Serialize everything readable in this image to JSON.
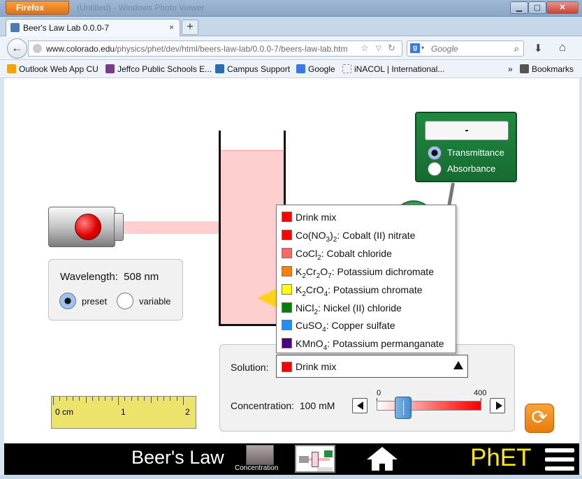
{
  "browser": {
    "firefox_label": "Firefox",
    "window_title": "(Untitled) - Windows Photo Viewer",
    "controls": {
      "minimize": "▁",
      "maximize": "▢",
      "close": "✕"
    },
    "tab": {
      "title": "Beer's Law Lab 0.0.0-7",
      "close": "×"
    },
    "new_tab": "+",
    "back": "←",
    "url_host": "www.colorado.edu",
    "url_path": "/physics/phet/dev/html/beers-law-lab/0.0.0-7/beers-law-lab.htm",
    "search_engine": "g",
    "search_placeholder": "Google",
    "bookmarks": [
      {
        "label": "Outlook Web App CU",
        "icon_color": "#f2a20c"
      },
      {
        "label": "Jeffco Public Schools E...",
        "icon_color": "#7a3b8f"
      },
      {
        "label": "Campus Support",
        "icon_color": "#2b6cb0"
      },
      {
        "label": "Google",
        "icon_color": "#3b78e7"
      },
      {
        "label": "iNACOL | International...",
        "icon_color": "#dddddd"
      }
    ],
    "bookmarks_overflow": "»",
    "bookmarks_menu": "Bookmarks"
  },
  "sim": {
    "wavelength": {
      "label": "Wavelength:",
      "value": "508 nm",
      "preset_label": "preset",
      "variable_label": "variable",
      "selected": "preset"
    },
    "meter": {
      "reading": "-",
      "transmittance_label": "Transmittance",
      "absorbance_label": "Absorbance",
      "selected": "transmittance"
    },
    "solution": {
      "label": "Solution:",
      "selected": "Drink mix",
      "selected_color": "#ff0000",
      "options": [
        {
          "label": "Drink mix",
          "color": "#ff0000"
        },
        {
          "label": "Co(NO3)2: Cobalt (II) nitrate",
          "color": "#ff0000"
        },
        {
          "label": "CoCl2: Cobalt chloride",
          "color": "#ff6666"
        },
        {
          "label": "K2Cr2O7: Potassium dichromate",
          "color": "#ff7f00"
        },
        {
          "label": "K2CrO4: Potassium chromate",
          "color": "#ffff00"
        },
        {
          "label": "NiCl2: Nickel (II) chloride",
          "color": "#008000"
        },
        {
          "label": "CuSO4: Copper sulfate",
          "color": "#1e90ff"
        },
        {
          "label": "KMnO4: Potassium permanganate",
          "color": "#4b0082"
        }
      ]
    },
    "concentration": {
      "label": "Concentration:",
      "value": "100 mM",
      "min": 0,
      "max": 400,
      "current": 100
    },
    "ruler": {
      "ticks": [
        "0 cm",
        "1",
        "2"
      ]
    },
    "solution_color": "#ffcfcf"
  },
  "nav": {
    "title": "Beer's Law",
    "screen_concentration": "Concentration",
    "logo": "PhET"
  }
}
